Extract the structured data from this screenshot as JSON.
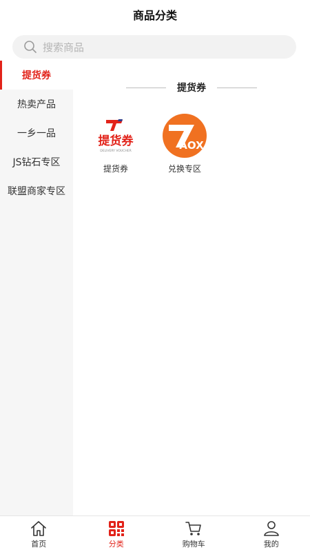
{
  "header": {
    "title": "商品分类"
  },
  "search": {
    "placeholder": "搜索商品"
  },
  "sidebar": {
    "items": [
      {
        "label": "提货券",
        "active": true
      },
      {
        "label": "热卖产品",
        "active": false
      },
      {
        "label": "一乡一品",
        "active": false
      },
      {
        "label": "JS钻石专区",
        "active": false
      },
      {
        "label": "联盟商家专区",
        "active": false
      }
    ]
  },
  "content": {
    "section_title": "提货券",
    "items": [
      {
        "label": "提货券",
        "icon": "voucher-logo",
        "logo_text": "提货券",
        "logo_subtext": "DELIVERY VOUCHER"
      },
      {
        "label": "兑换专区",
        "icon": "aox-logo",
        "logo_text": "AOX"
      }
    ]
  },
  "tabbar": {
    "items": [
      {
        "label": "首页",
        "icon": "home-icon",
        "active": false
      },
      {
        "label": "分类",
        "icon": "category-icon",
        "active": true
      },
      {
        "label": "购物车",
        "icon": "cart-icon",
        "active": false
      },
      {
        "label": "我的",
        "icon": "user-icon",
        "active": false
      }
    ]
  },
  "colors": {
    "accent": "#e2231a",
    "logo_orange": "#f07121",
    "sidebar_bg": "#f6f6f6"
  }
}
